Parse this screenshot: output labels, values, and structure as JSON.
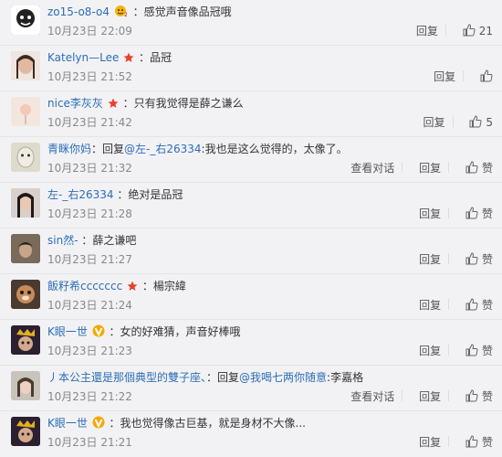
{
  "comments": [
    {
      "user": "zo15-o8-o4",
      "badge": "vip-face",
      "content": "：感觉声音像品冠哦",
      "date": "10月23日 22:09",
      "reply": "回复",
      "like": "21",
      "avatar_color": "#2e2e2e"
    },
    {
      "user": "Katelyn—Lee",
      "badge": "star",
      "content": "：品冠",
      "date": "10月23日 21:52",
      "reply": "回复",
      "like": "",
      "avatar_color": "#c9a089"
    },
    {
      "user": "nice李灰灰",
      "badge": "star",
      "content": "：只有我觉得是薛之谦么",
      "date": "10月23日 21:42",
      "reply": "回复",
      "like": "5",
      "avatar_color": "#e8d8c8"
    },
    {
      "user": "青眯你妈",
      "content_prefix": "：回复",
      "mention": "@左-_右26334",
      "content": ":我也是这么觉得的，太像了。",
      "date": "10月23日 21:32",
      "view": "查看对话",
      "reply": "回复",
      "like": "赞",
      "avatar_color": "#d6d2c2"
    },
    {
      "user": "左-_右26334",
      "content": "：绝对是品冠",
      "date": "10月23日 21:28",
      "reply": "回复",
      "like": "赞",
      "avatar_color": "#3a3030"
    },
    {
      "user": "sin然-",
      "content": "：薛之谦吧",
      "date": "10月23日 21:27",
      "reply": "回复",
      "like": "赞",
      "avatar_color": "#5a4a3e"
    },
    {
      "user": "飯籽希ccccccc",
      "badge": "star",
      "content": "：楊宗緯",
      "date": "10月23日 21:24",
      "reply": "回复",
      "like": "赞",
      "avatar_color": "#6a5040"
    },
    {
      "user": "K眼一世",
      "badge": "v-yellow",
      "content": "：女的好难猜，声音好棒哦",
      "date": "10月23日 21:23",
      "reply": "回复",
      "like": "赞",
      "avatar_color": "#2a2030"
    },
    {
      "user": "丿本公主還是那個典型的雙子座、",
      "content_prefix": "：回复",
      "mention": "@我喝七两你随意",
      "content": ":李嘉格",
      "date": "10月23日 21:22",
      "view": "查看对话",
      "reply": "回复",
      "like": "赞",
      "avatar_color": "#b8b4ae"
    },
    {
      "user": "K眼一世",
      "badge": "v-yellow",
      "content": "：我也觉得像古巨基，就是身材不大像...",
      "date": "10月23日 21:21",
      "reply": "回复",
      "like": "赞",
      "avatar_color": "#2a2030"
    }
  ]
}
